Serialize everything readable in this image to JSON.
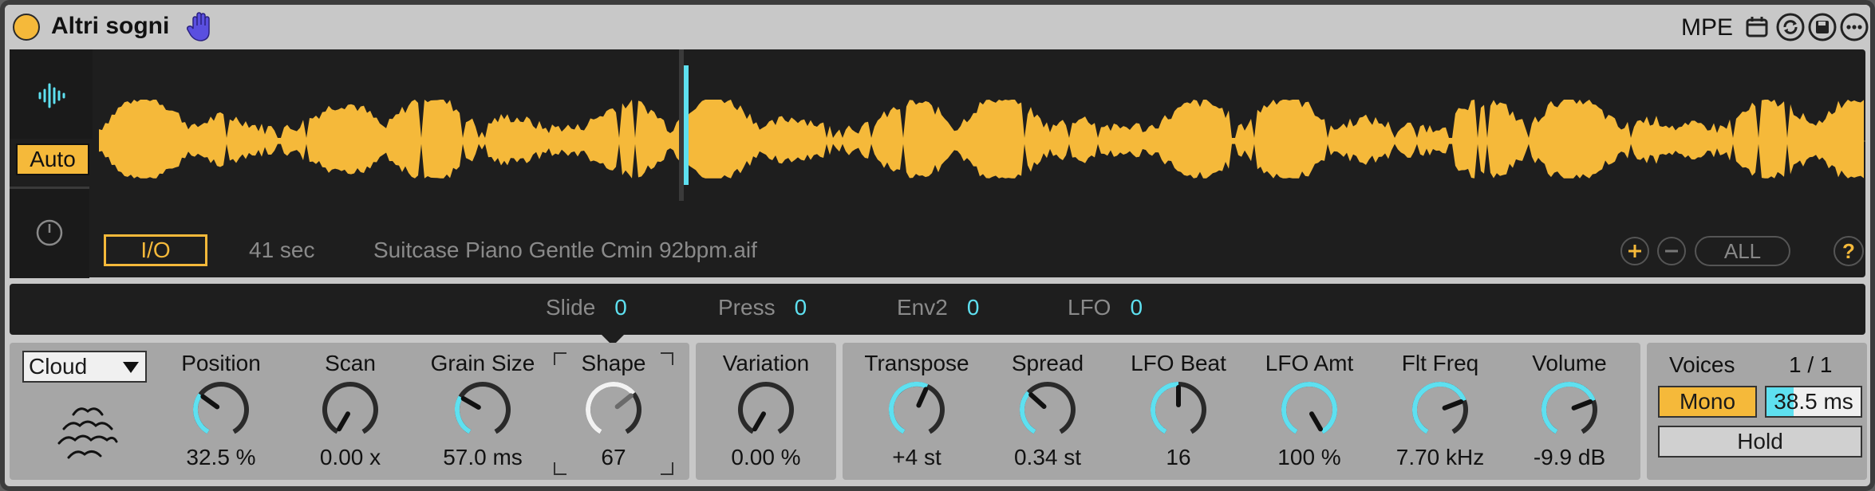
{
  "header": {
    "title": "Altri sogni",
    "mpe_label": "MPE",
    "icons": [
      "power-dot",
      "hand-icon",
      "mpe-icon",
      "refresh-icon",
      "save-icon",
      "more-icon"
    ]
  },
  "waveform": {
    "side_auto_label": "Auto",
    "io_label": "I/O",
    "duration": "41 sec",
    "filename": "Suitcase Piano Gentle Cmin 92bpm.aif",
    "all_label": "ALL",
    "help_label": "?",
    "playhead_fraction": 0.33,
    "colors": {
      "wave": "#f5b93a",
      "playhead": "#5ee0f0",
      "bg": "#1e1e1e"
    }
  },
  "modulation": [
    {
      "label": "Slide",
      "value": "0"
    },
    {
      "label": "Press",
      "value": "0"
    },
    {
      "label": "Env2",
      "value": "0"
    },
    {
      "label": "LFO",
      "value": "0"
    }
  ],
  "grain_section": {
    "mode": "Cloud",
    "knobs": [
      {
        "id": "position",
        "label": "Position",
        "value": "32.5 %",
        "level": 0.32
      },
      {
        "id": "scan",
        "label": "Scan",
        "value": "0.00 x",
        "level": 0.0
      },
      {
        "id": "grain-size",
        "label": "Grain Size",
        "value": "57.0 ms",
        "level": 0.3
      },
      {
        "id": "shape",
        "label": "Shape",
        "value": "67",
        "level": 0.67
      }
    ]
  },
  "variation": {
    "label": "Variation",
    "value": "0.00 %",
    "level": 0.0
  },
  "pitch_section": {
    "knobs": [
      {
        "id": "transpose",
        "label": "Transpose",
        "value": "+4 st",
        "level": 0.58
      },
      {
        "id": "spread",
        "label": "Spread",
        "value": "0.34 st",
        "level": 0.34
      },
      {
        "id": "lfo-beat",
        "label": "LFO Beat",
        "value": "16",
        "level": 0.5
      },
      {
        "id": "lfo-amt",
        "label": "LFO Amt",
        "value": "100 %",
        "level": 1.0
      },
      {
        "id": "flt-freq",
        "label": "Flt Freq",
        "value": "7.70 kHz",
        "level": 0.73
      },
      {
        "id": "volume",
        "label": "Volume",
        "value": "-9.9 dB",
        "level": 0.73
      }
    ]
  },
  "voices": {
    "label": "Voices",
    "value": "1 / 1",
    "mono_label": "Mono",
    "glide_value": "38.5 ms",
    "glide_level": 0.29,
    "hold_label": "Hold"
  }
}
